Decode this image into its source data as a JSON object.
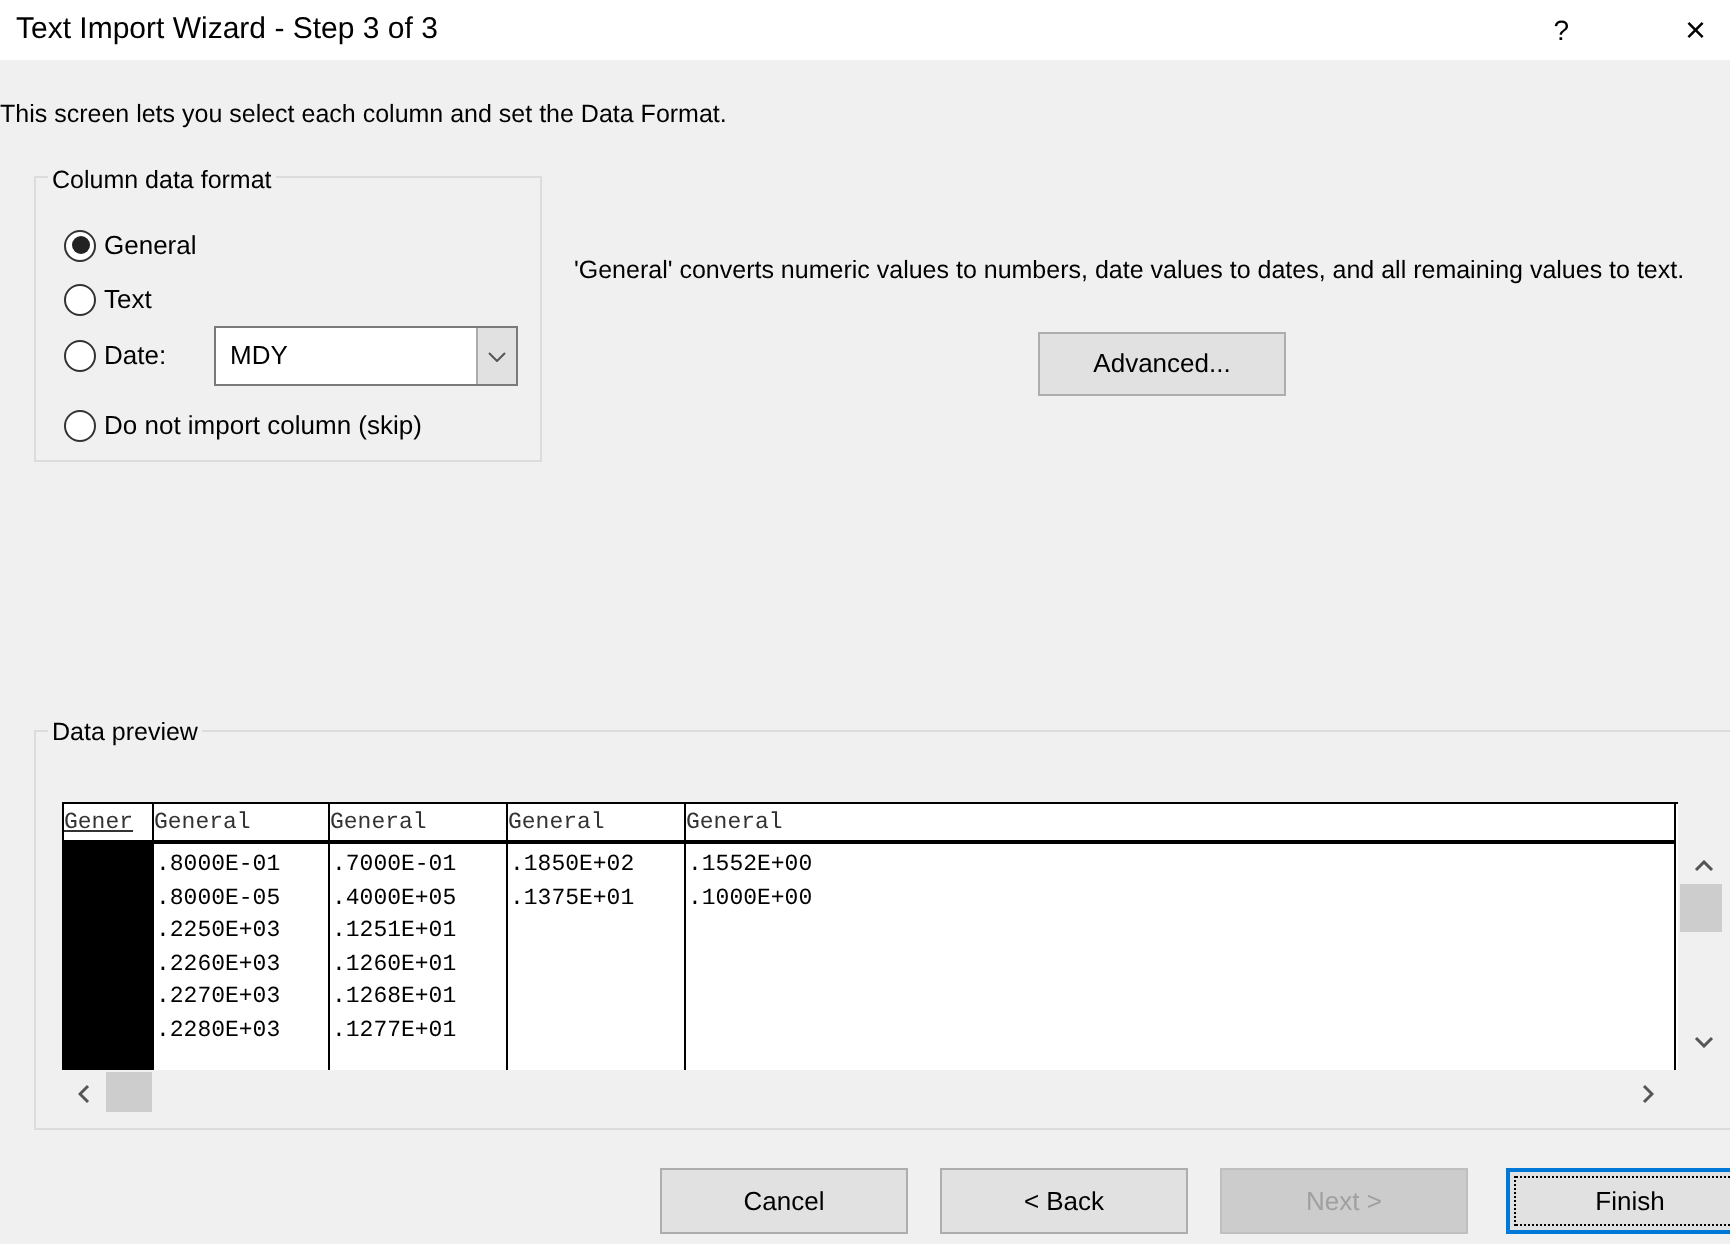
{
  "window": {
    "title": "Text Import Wizard - Step 3 of 3",
    "help": "?",
    "close": "×"
  },
  "intro": "This screen lets you select each column and set the Data Format.",
  "column_data_format": {
    "title": "Column data format",
    "options": [
      {
        "label": "General",
        "selected": true
      },
      {
        "label": "Text",
        "selected": false
      },
      {
        "label": "Date:",
        "selected": false,
        "kind": "date",
        "value": "MDY"
      },
      {
        "label": "Do not import column (skip)",
        "selected": false
      }
    ]
  },
  "description": "'General' converts numeric values to numbers, date values to dates, and all remaining values to text.",
  "advanced_button": "Advanced...",
  "data_preview": {
    "title": "Data preview",
    "columns": [
      {
        "header": "Gener",
        "selected": true
      },
      {
        "header": "General",
        "selected": false,
        "cells": [
          ".8000E-01",
          ".8000E-05",
          ".2250E+03",
          ".2260E+03",
          ".2270E+03",
          ".2280E+03"
        ]
      },
      {
        "header": "General",
        "selected": false,
        "cells": [
          ".7000E-01",
          ".4000E+05",
          ".1251E+01",
          ".1260E+01",
          ".1268E+01",
          ".1277E+01"
        ]
      },
      {
        "header": "General",
        "selected": false,
        "cells": [
          ".1850E+02",
          ".1375E+01"
        ]
      },
      {
        "header": "General",
        "selected": false,
        "cells": [
          ".1552E+00",
          ".1000E+00"
        ]
      }
    ]
  },
  "buttons": [
    {
      "label": "Cancel",
      "disabled": false,
      "default": false
    },
    {
      "label": "< Back",
      "disabled": false,
      "default": false
    },
    {
      "label": "Next >",
      "disabled": true,
      "default": false
    },
    {
      "label": "Finish",
      "disabled": false,
      "default": true
    }
  ]
}
